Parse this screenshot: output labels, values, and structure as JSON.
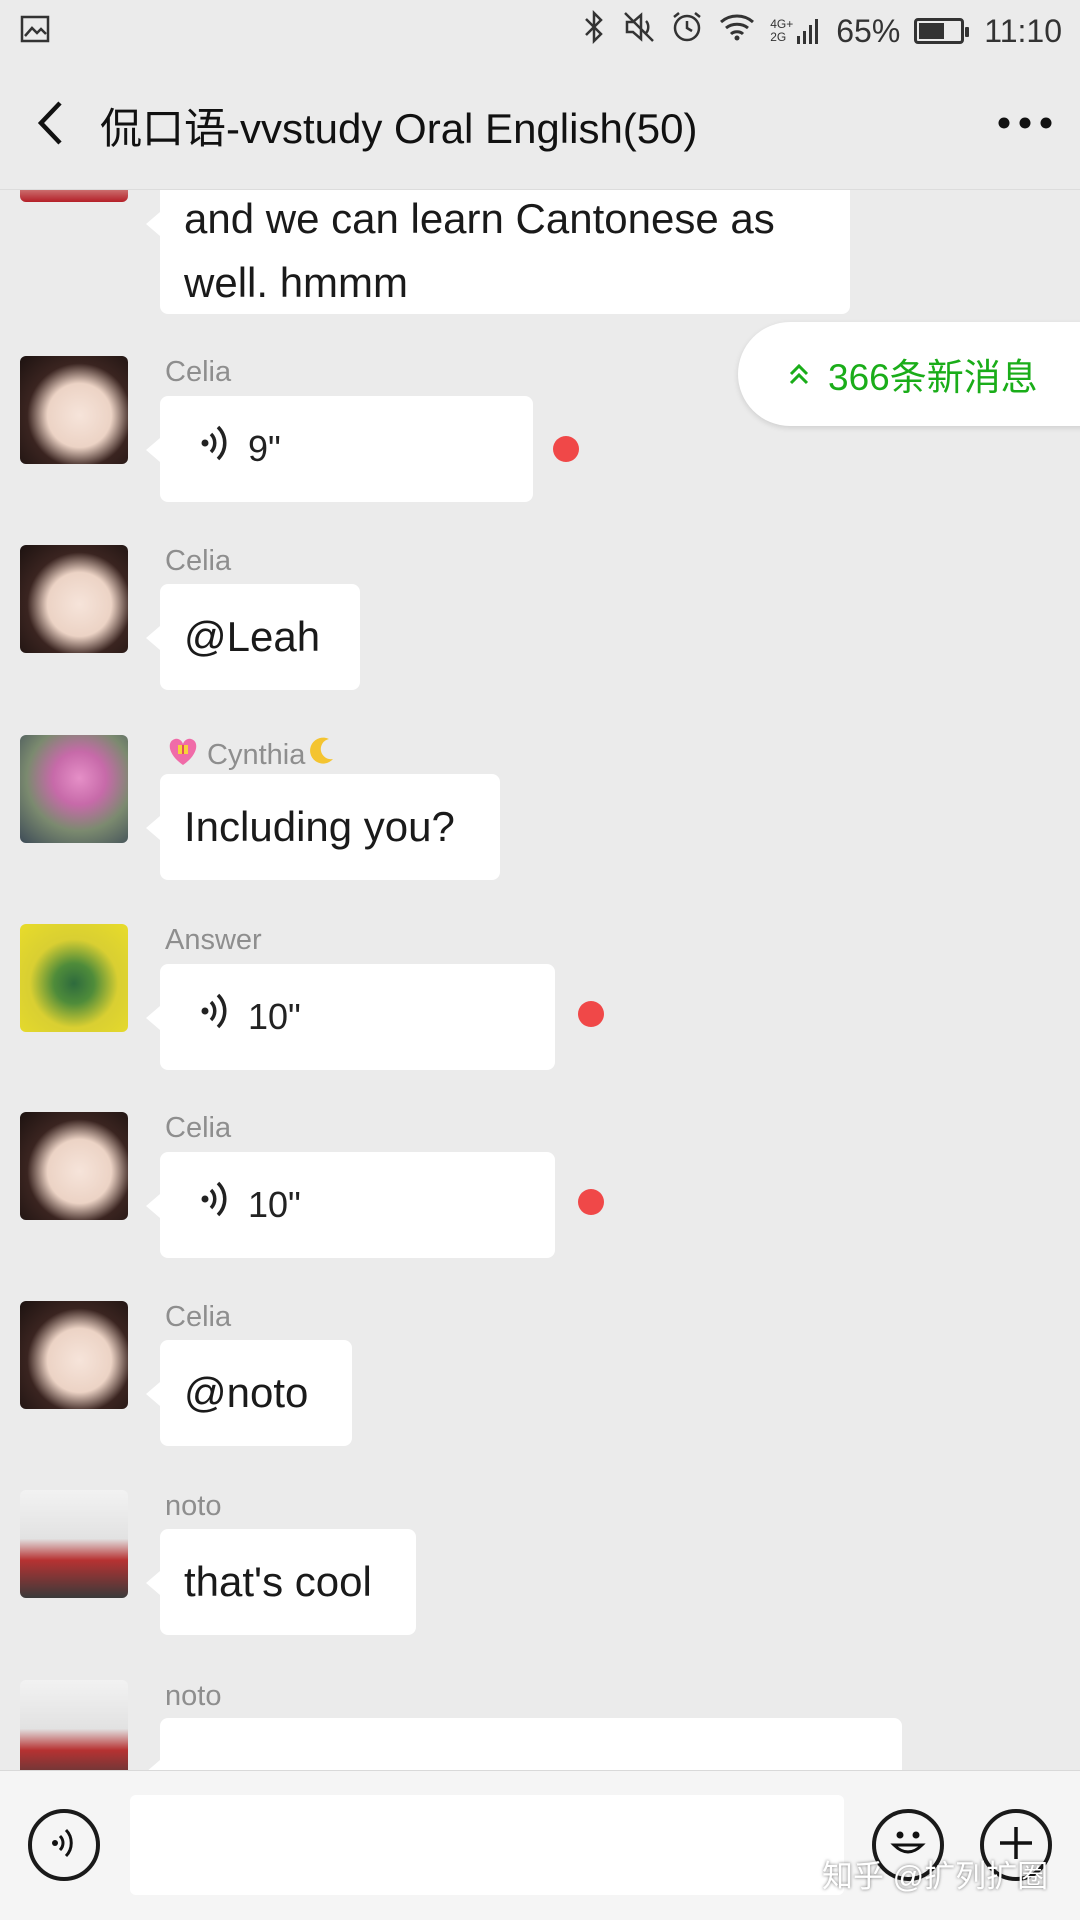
{
  "status_bar": {
    "left_icon": "image-icon",
    "network_top": "4G+",
    "network_bottom": "2G",
    "battery": "65%",
    "battery_level": 0.65,
    "time": "11:10"
  },
  "header": {
    "title": "侃口语-vvstudy Oral English(50)",
    "back_icon": "back-chevron-icon",
    "more_icon": "more-dots-icon"
  },
  "new_messages": {
    "label": "366条新消息",
    "icon": "double-chevron-up-icon",
    "color": "#1aad19"
  },
  "messages": [
    {
      "sender": "",
      "type": "text",
      "lines": [
        "and we can learn Cantonese as",
        "well. hmmm"
      ]
    },
    {
      "sender": "Celia",
      "type": "voice",
      "duration": "9\"",
      "unread": true
    },
    {
      "sender": "Celia",
      "type": "text",
      "text": "@Leah"
    },
    {
      "sender": "Cynthia",
      "type": "text",
      "text": "Including you?"
    },
    {
      "sender": "Answer",
      "type": "voice",
      "duration": "10\"",
      "unread": true
    },
    {
      "sender": "Celia",
      "type": "voice",
      "duration": "10\"",
      "unread": true
    },
    {
      "sender": "Celia",
      "type": "text",
      "text": "@noto"
    },
    {
      "sender": "noto",
      "type": "text",
      "text": "that's cool"
    },
    {
      "sender": "noto",
      "type": "text",
      "text": ""
    }
  ],
  "input_bar": {
    "voice_icon": "voice-mode-icon",
    "input_value": "",
    "emoji_icon": "emoji-icon",
    "plus_icon": "plus-icon"
  },
  "watermark": "知乎 @扩列扩圈",
  "colors": {
    "background": "#ebebeb",
    "bubble": "#ffffff",
    "unread_dot": "#f04848",
    "accent": "#1aad19"
  }
}
